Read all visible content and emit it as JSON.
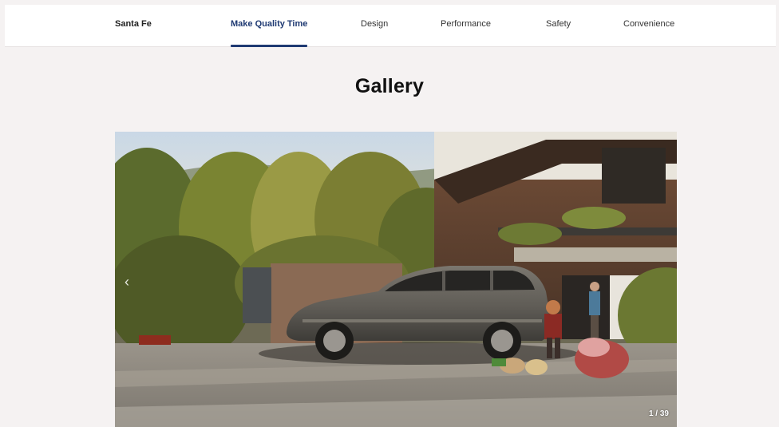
{
  "nav": {
    "model": "Santa Fe",
    "items": [
      {
        "label": "Make Quality Time",
        "active": true
      },
      {
        "label": "Design",
        "active": false
      },
      {
        "label": "Performance",
        "active": false
      },
      {
        "label": "Safety",
        "active": false
      },
      {
        "label": "Convenience",
        "active": false
      }
    ]
  },
  "gallery": {
    "title": "Gallery",
    "counter": "1 / 39",
    "prev_icon": "chevron-left-icon",
    "image_subject": "gray-suv-parked-in-front-of-modern-house"
  },
  "colors": {
    "accent": "#1f3a73",
    "page_bg": "#f5f2f2",
    "nav_bg": "#ffffff"
  }
}
